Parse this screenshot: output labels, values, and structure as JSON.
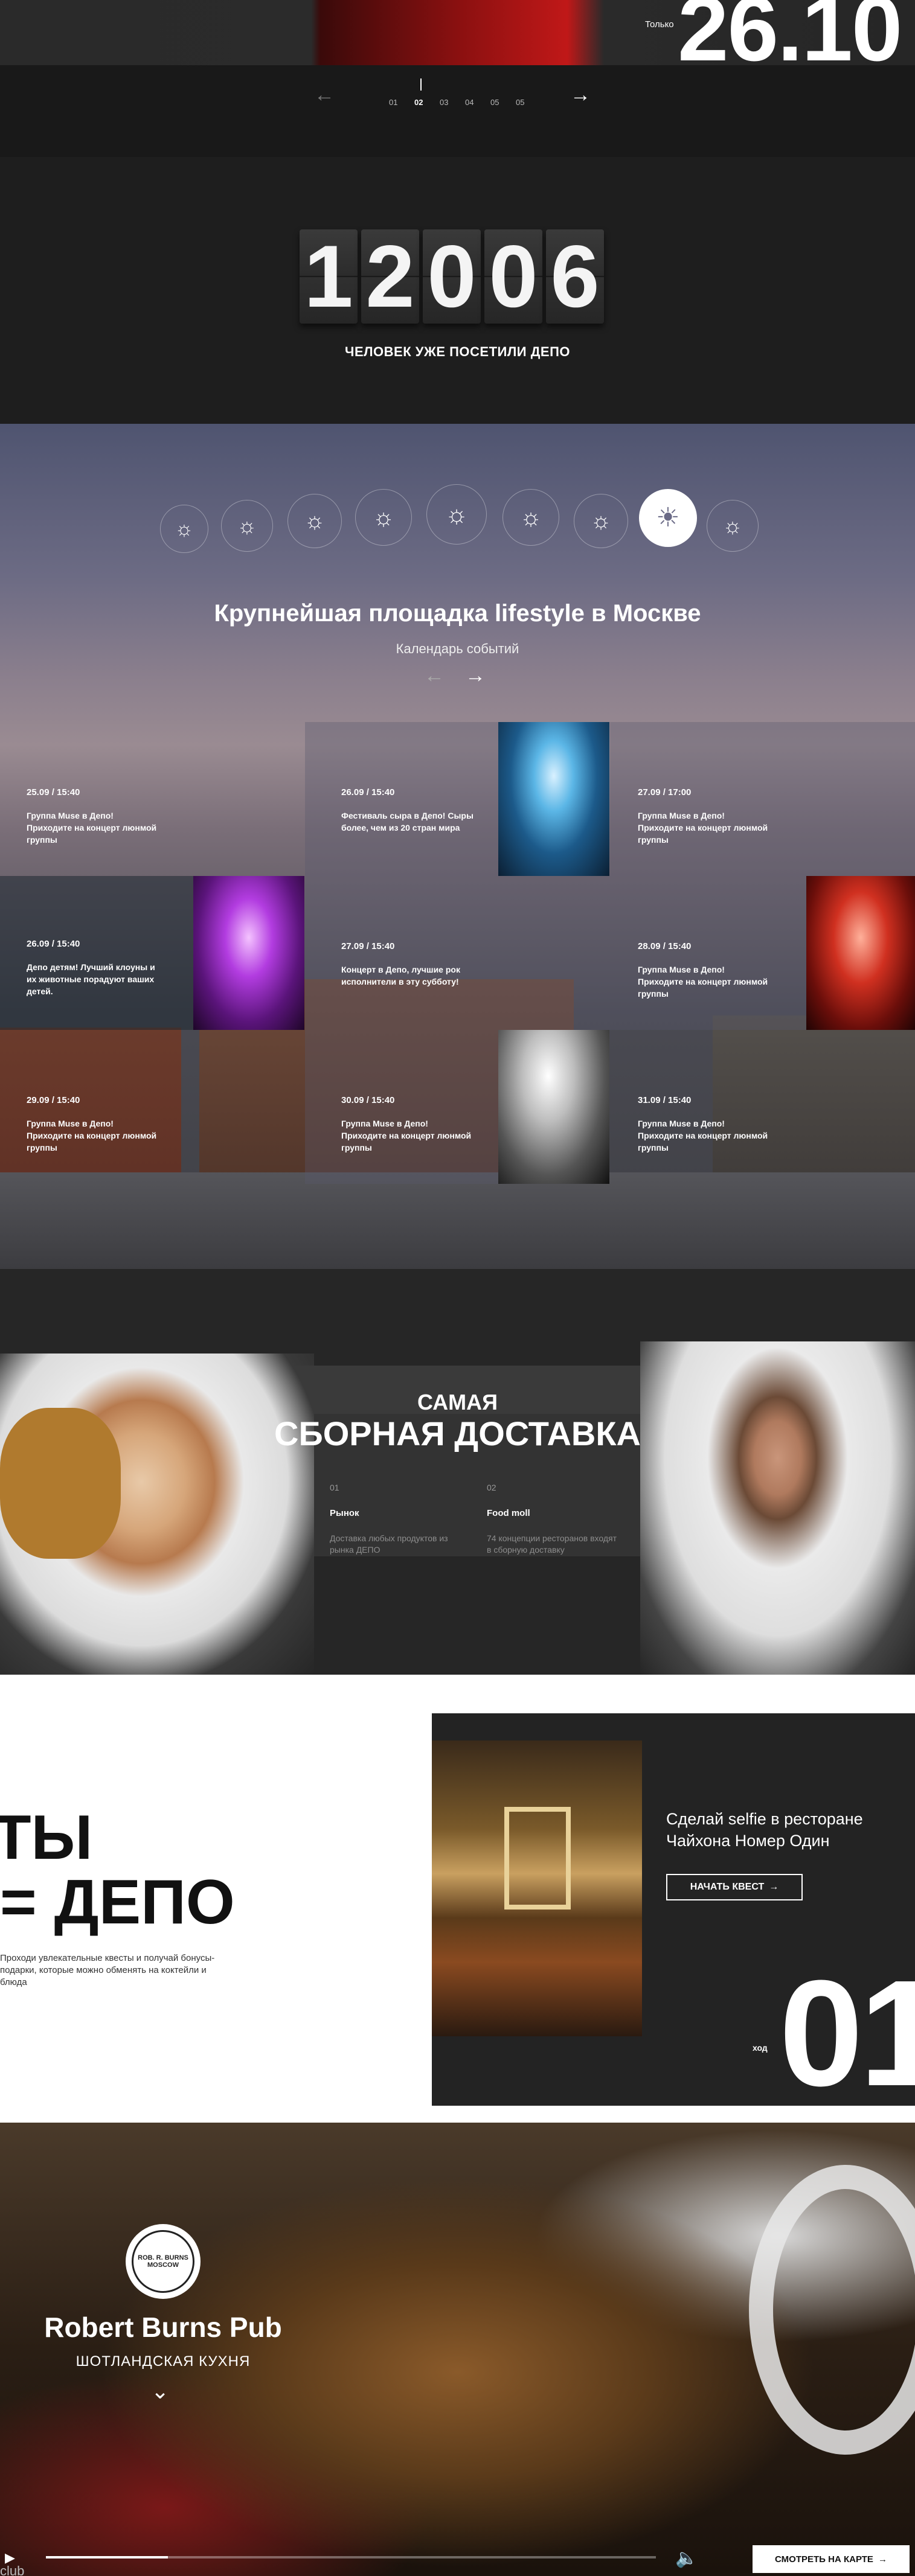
{
  "top_slider": {
    "only_label": "Только",
    "date": "26.10",
    "prev_arrow": "←",
    "next_arrow": "→",
    "pages": [
      "01",
      "02",
      "03",
      "04",
      "05",
      "05"
    ],
    "active_page": "02"
  },
  "counter": {
    "digits": [
      "1",
      "2",
      "0",
      "0",
      "6"
    ],
    "label": "ЧЕЛОВЕК УЖЕ ПОСЕТИЛИ ДЕПО"
  },
  "events": {
    "weather_icons": [
      "sun-icon",
      "sun-icon",
      "sun-icon",
      "sun-icon",
      "sun-icon",
      "sun-icon",
      "sun-icon",
      "sun-icon",
      "sun-icon"
    ],
    "active_weather": 7,
    "title": "Крупнейшая площадка lifestyle в Москве",
    "subtitle": "Календарь событий",
    "prev_arrow": "←",
    "next_arrow": "→",
    "cards": [
      {
        "date": "25.09 / 15:40",
        "text": "Группа Muse в Депо! Приходите на концерт люнмой группы"
      },
      {
        "date": "26.09 / 15:40",
        "text": "Фестиваль сыра в Депо! Сыры более, чем из 20 стран мира"
      },
      {
        "date": "27.09 / 17:00",
        "text": "Группа Muse в Депо! Приходите на концерт люнмой группы"
      },
      {
        "date": "26.09 / 15:40",
        "text": "Депо детям! Лучший клоуны и их животные порадуют ваших детей."
      },
      {
        "date": "27.09 / 15:40",
        "text": "Концерт в Депо, лучшие рок исполнители в эту субботу!"
      },
      {
        "date": "28.09 / 15:40",
        "text": "Группа Muse в Депо! Приходите на концерт люнмой группы"
      },
      {
        "date": "29.09 / 15:40",
        "text": "Группа Muse в Депо! Приходите на концерт люнмой группы"
      },
      {
        "date": "30.09 / 15:40",
        "text": "Группа Muse в Депо! Приходите на концерт люнмой группы"
      },
      {
        "date": "31.09 / 15:40",
        "text": "Группа Muse в Депо! Приходите на концерт люнмой группы"
      }
    ]
  },
  "delivery": {
    "kicker": "САМАЯ",
    "title": "СБОРНАЯ ДОСТАВКА",
    "items": [
      {
        "num": "01",
        "name": "Рынок",
        "desc": "Доставка любых продуктов из рынка ДЕПО"
      },
      {
        "num": "02",
        "name": "Food moll",
        "desc": "74 концепции ресторанов входят в сборную доставку"
      }
    ]
  },
  "quest": {
    "you": "ТЫ",
    "equals_depo": "= ДЕПО",
    "description": "Проходи увлекательные квесты и получай бонусы-подарки, которые можно обменять на коктейли и блюда",
    "panel_heading": "Сделай selfie в ресторане Чайхона Номер Один",
    "button": "НАЧАТЬ КВЕСТ",
    "button_icon": "→",
    "step_label": "ход",
    "step_number": "01"
  },
  "pub": {
    "logo_text": "ROB. R. BURNS MOSCOW",
    "name": "Robert Burns Pub",
    "cuisine": "ШОТЛАНДСКАЯ КУХНЯ",
    "chevron": "⌄",
    "play_icon": "▶",
    "volume_icon": "🔈",
    "progress": 0.2,
    "map_button": "СМОТРЕТЬ НА КАРТЕ",
    "map_button_icon": "→",
    "partial_text": "club"
  },
  "colors": {
    "accent_red": "#c01818",
    "dark_bg": "#1c1c1c",
    "band": "#333333"
  }
}
